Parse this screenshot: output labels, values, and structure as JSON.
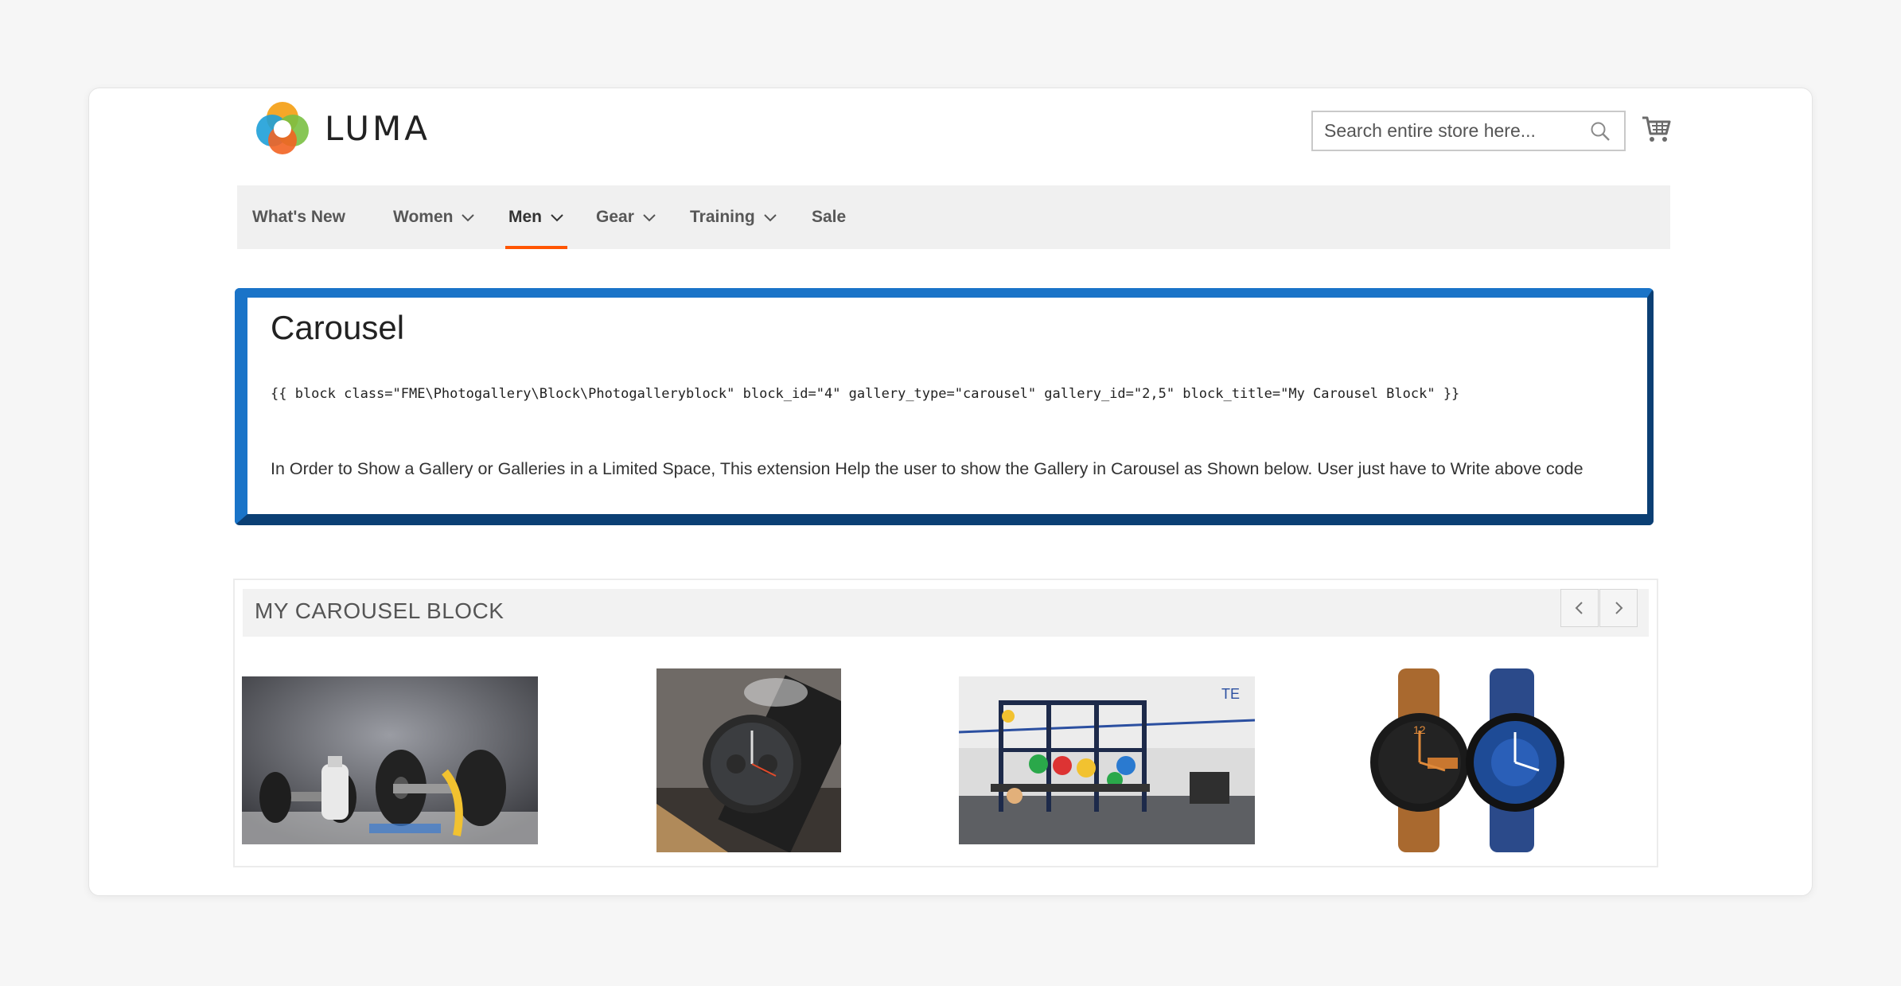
{
  "header": {
    "logo_text": "LUMA",
    "search": {
      "placeholder": "Search entire store here..."
    }
  },
  "nav": {
    "items": [
      {
        "label": "What's New",
        "dropdown": false
      },
      {
        "label": "Women",
        "dropdown": true
      },
      {
        "label": "Men",
        "dropdown": true,
        "active": true
      },
      {
        "label": "Gear",
        "dropdown": true
      },
      {
        "label": "Training",
        "dropdown": true
      },
      {
        "label": "Sale",
        "dropdown": false
      }
    ],
    "active_color": "#ff5501"
  },
  "info": {
    "title": "Carousel",
    "code": "{{ block class=\"FME\\Photogallery\\Block\\Photogalleryblock\" block_id=\"4\" gallery_type=\"carousel\" gallery_id=\"2,5\" block_title=\"My Carousel Block\" }}",
    "description": "In Order to Show a Gallery or Galleries in a Limited Space, This extension Help the user to show the Gallery in Carousel as Shown below. User just have to Write above code",
    "border_color": "#1565b4"
  },
  "carousel": {
    "title": "MY CAROUSEL BLOCK",
    "images": [
      "dumbbells-image",
      "watch-image",
      "gym-rack-image",
      "watches-pair-image"
    ]
  }
}
